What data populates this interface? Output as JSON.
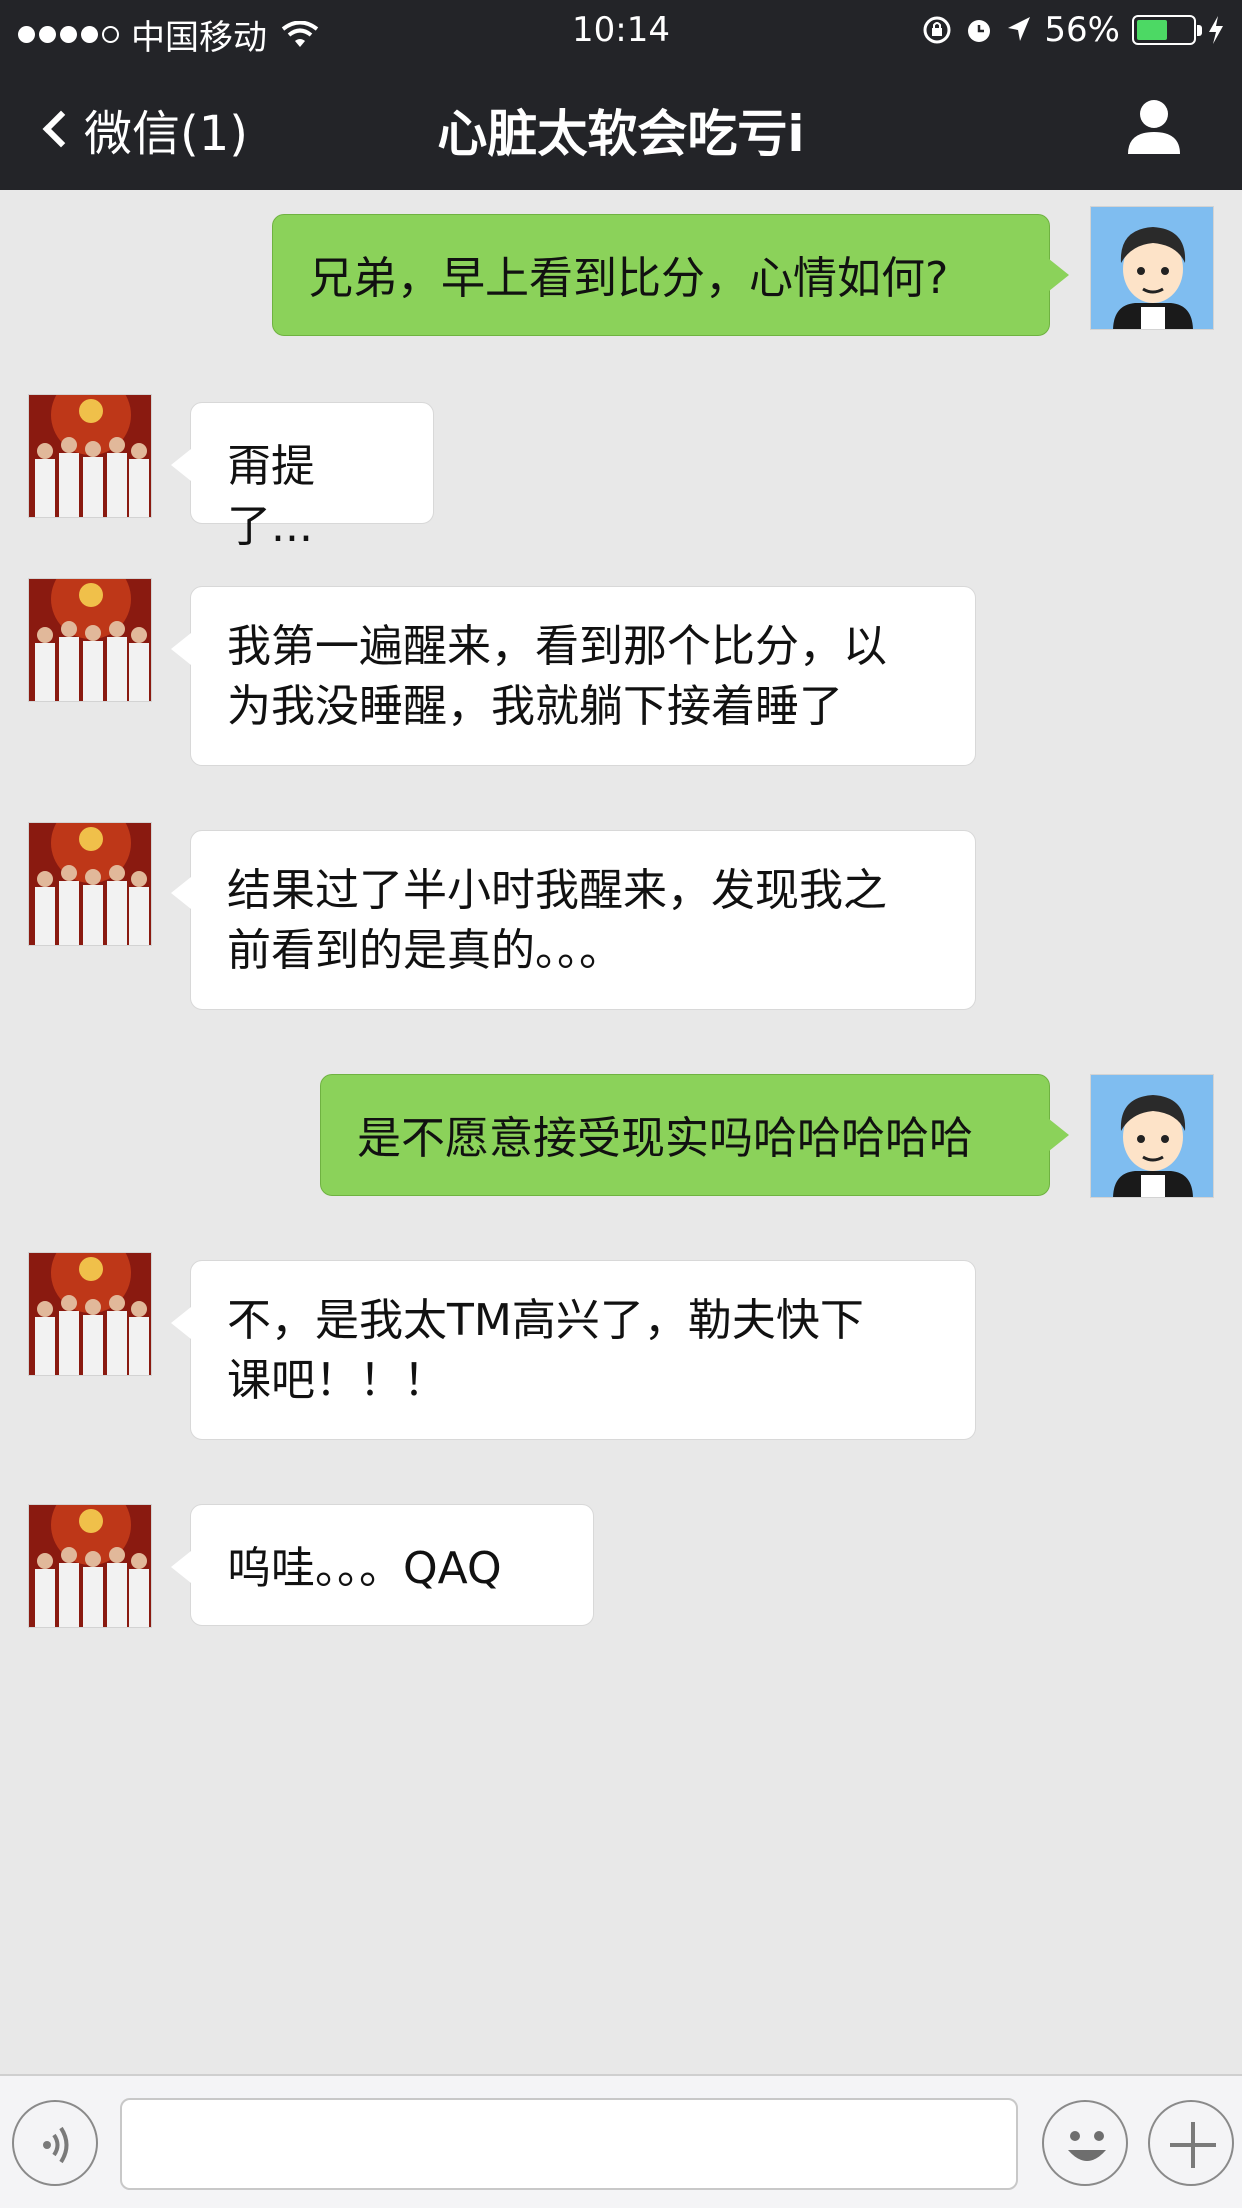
{
  "status_bar": {
    "carrier": "中国移动",
    "time": "10:14",
    "battery_percent": "56%",
    "battery_level": 0.56
  },
  "nav": {
    "back_label": "微信(1)",
    "title": "心脏太软会吃亏i"
  },
  "messages": [
    {
      "sender": "self",
      "text": "兄弟，早上看到比分，心情如何?"
    },
    {
      "sender": "other",
      "text": "甭提了..."
    },
    {
      "sender": "other",
      "lines": [
        "我第一遍醒来，看到那个比分，以",
        "为我没睡醒，我就躺下接着睡了"
      ]
    },
    {
      "sender": "other",
      "lines": [
        "结果过了半小时我醒来，发现我之",
        "前看到的是真的。。。"
      ]
    },
    {
      "sender": "self",
      "text": "是不愿意接受现实吗哈哈哈哈哈"
    },
    {
      "sender": "other",
      "lines": [
        "不，是我太TM高兴了，勒夫快下",
        "课吧！！！"
      ]
    },
    {
      "sender": "other",
      "text": "呜哇。。。QAQ"
    }
  ],
  "input": {
    "placeholder": ""
  },
  "colors": {
    "nav_bg": "#232428",
    "chat_bg": "#e8e8e8",
    "self_bubble": "#8bd25a",
    "other_bubble": "#ffffff",
    "battery_fill": "#4cd964"
  },
  "icons": {
    "back": "chevron-left-icon",
    "profile": "person-icon",
    "voice": "voice-icon",
    "emoji": "smiley-icon",
    "plus": "plus-icon",
    "wifi": "wifi-icon",
    "lock": "orientation-lock-icon",
    "alarm": "alarm-icon",
    "location": "location-arrow-icon",
    "charging": "charging-bolt-icon"
  }
}
